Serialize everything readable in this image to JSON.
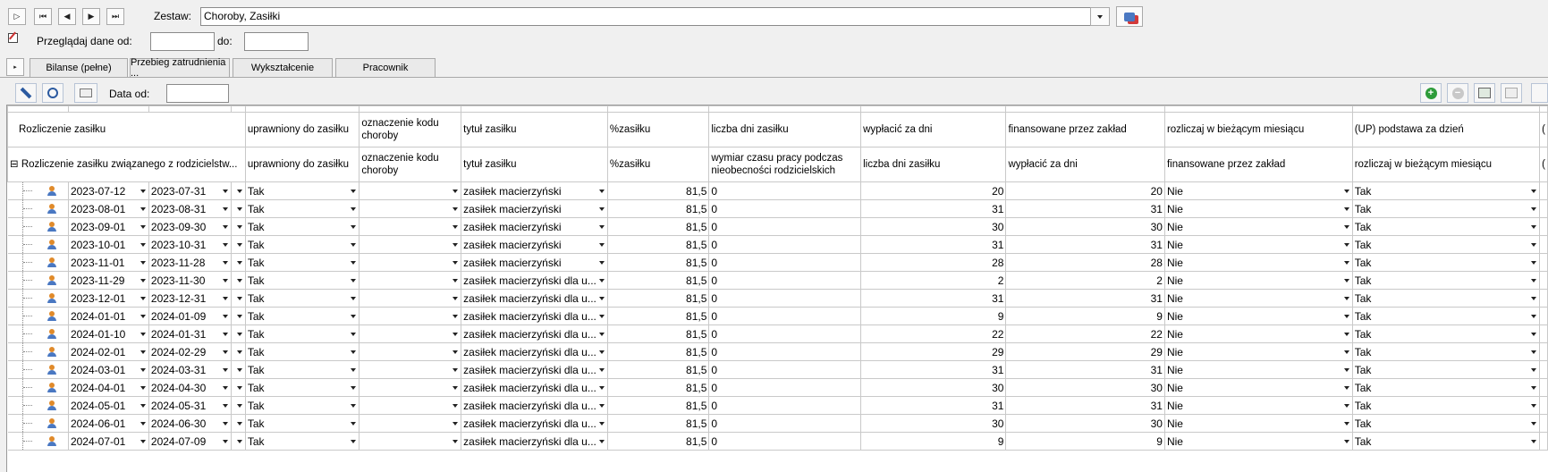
{
  "toolbar": {
    "zestaw_label": "Zestaw:",
    "zestaw_value": "Choroby, Zasiłki",
    "przegladaj_label": "Przeglądaj dane od:",
    "do_label": "do:",
    "od_value": "",
    "do_value": ""
  },
  "tabs": [
    "Bilanse (pełne)",
    "Przebieg zatrudnienia ...",
    "Wykształcenie",
    "Pracownik"
  ],
  "grid_toolbar": {
    "data_od_label": "Data od:",
    "data_od_value": ""
  },
  "columns_top": [
    "Rozliczenie zasiłku",
    "uprawniony do zasiłku",
    "oznaczenie kodu choroby",
    "tytuł zasiłku",
    "%zasiłku",
    "liczba dni zasiłku",
    "wypłacić za dni",
    "finansowane przez zakład",
    "rozliczaj w bieżącym miesiącu",
    "(UP) podstawa za dzień",
    "("
  ],
  "columns_sub": [
    "Rozliczenie zasiłku związanego z rodzicielstw...",
    "uprawniony do zasiłku",
    "oznaczenie kodu choroby",
    "tytuł zasiłku",
    "%zasiłku",
    "wymiar czasu pracy podczas nieobecności rodzicielskich",
    "liczba dni zasiłku",
    "wypłacić za dni",
    "finansowane przez zakład",
    "rozliczaj w bieżącym miesiącu",
    "("
  ],
  "rows": [
    {
      "od": "2023-07-12",
      "do": "2023-07-31",
      "upr": "Tak",
      "kod": "",
      "tytul": "zasiłek macierzyński",
      "pct": "81,5",
      "wym": "0",
      "dni": "20",
      "wyp": "20",
      "fin": "Nie",
      "rozl": "Tak"
    },
    {
      "od": "2023-08-01",
      "do": "2023-08-31",
      "upr": "Tak",
      "kod": "",
      "tytul": "zasiłek macierzyński",
      "pct": "81,5",
      "wym": "0",
      "dni": "31",
      "wyp": "31",
      "fin": "Nie",
      "rozl": "Tak"
    },
    {
      "od": "2023-09-01",
      "do": "2023-09-30",
      "upr": "Tak",
      "kod": "",
      "tytul": "zasiłek macierzyński",
      "pct": "81,5",
      "wym": "0",
      "dni": "30",
      "wyp": "30",
      "fin": "Nie",
      "rozl": "Tak"
    },
    {
      "od": "2023-10-01",
      "do": "2023-10-31",
      "upr": "Tak",
      "kod": "",
      "tytul": "zasiłek macierzyński",
      "pct": "81,5",
      "wym": "0",
      "dni": "31",
      "wyp": "31",
      "fin": "Nie",
      "rozl": "Tak"
    },
    {
      "od": "2023-11-01",
      "do": "2023-11-28",
      "upr": "Tak",
      "kod": "",
      "tytul": "zasiłek macierzyński",
      "pct": "81,5",
      "wym": "0",
      "dni": "28",
      "wyp": "28",
      "fin": "Nie",
      "rozl": "Tak"
    },
    {
      "od": "2023-11-29",
      "do": "2023-11-30",
      "upr": "Tak",
      "kod": "",
      "tytul": "zasiłek macierzyński dla u...",
      "pct": "81,5",
      "wym": "0",
      "dni": "2",
      "wyp": "2",
      "fin": "Nie",
      "rozl": "Tak"
    },
    {
      "od": "2023-12-01",
      "do": "2023-12-31",
      "upr": "Tak",
      "kod": "",
      "tytul": "zasiłek macierzyński dla u...",
      "pct": "81,5",
      "wym": "0",
      "dni": "31",
      "wyp": "31",
      "fin": "Nie",
      "rozl": "Tak"
    },
    {
      "od": "2024-01-01",
      "do": "2024-01-09",
      "upr": "Tak",
      "kod": "",
      "tytul": "zasiłek macierzyński dla u...",
      "pct": "81,5",
      "wym": "0",
      "dni": "9",
      "wyp": "9",
      "fin": "Nie",
      "rozl": "Tak"
    },
    {
      "od": "2024-01-10",
      "do": "2024-01-31",
      "upr": "Tak",
      "kod": "",
      "tytul": "zasiłek macierzyński dla u...",
      "pct": "81,5",
      "wym": "0",
      "dni": "22",
      "wyp": "22",
      "fin": "Nie",
      "rozl": "Tak"
    },
    {
      "od": "2024-02-01",
      "do": "2024-02-29",
      "upr": "Tak",
      "kod": "",
      "tytul": "zasiłek macierzyński dla u...",
      "pct": "81,5",
      "wym": "0",
      "dni": "29",
      "wyp": "29",
      "fin": "Nie",
      "rozl": "Tak"
    },
    {
      "od": "2024-03-01",
      "do": "2024-03-31",
      "upr": "Tak",
      "kod": "",
      "tytul": "zasiłek macierzyński dla u...",
      "pct": "81,5",
      "wym": "0",
      "dni": "31",
      "wyp": "31",
      "fin": "Nie",
      "rozl": "Tak"
    },
    {
      "od": "2024-04-01",
      "do": "2024-04-30",
      "upr": "Tak",
      "kod": "",
      "tytul": "zasiłek macierzyński dla u...",
      "pct": "81,5",
      "wym": "0",
      "dni": "30",
      "wyp": "30",
      "fin": "Nie",
      "rozl": "Tak"
    },
    {
      "od": "2024-05-01",
      "do": "2024-05-31",
      "upr": "Tak",
      "kod": "",
      "tytul": "zasiłek macierzyński dla u...",
      "pct": "81,5",
      "wym": "0",
      "dni": "31",
      "wyp": "31",
      "fin": "Nie",
      "rozl": "Tak"
    },
    {
      "od": "2024-06-01",
      "do": "2024-06-30",
      "upr": "Tak",
      "kod": "",
      "tytul": "zasiłek macierzyński dla u...",
      "pct": "81,5",
      "wym": "0",
      "dni": "30",
      "wyp": "30",
      "fin": "Nie",
      "rozl": "Tak"
    },
    {
      "od": "2024-07-01",
      "do": "2024-07-09",
      "upr": "Tak",
      "kod": "",
      "tytul": "zasiłek macierzyński dla u...",
      "pct": "81,5",
      "wym": "0",
      "dni": "9",
      "wyp": "9",
      "fin": "Nie",
      "rozl": "Tak"
    }
  ],
  "colors": {
    "accent_green": "#2e9c3a",
    "person_icon": "#e08a2a",
    "border": "#c9c9c9"
  }
}
